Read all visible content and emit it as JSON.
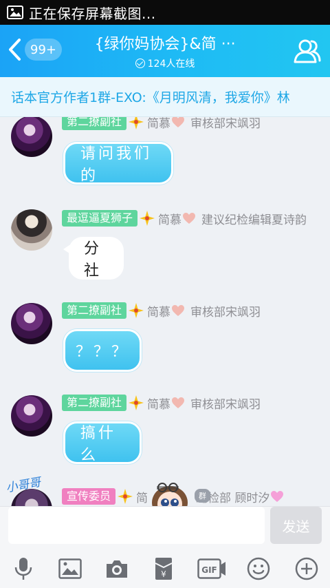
{
  "status_bar": {
    "text": "正在保存屏幕截图..."
  },
  "header": {
    "unread_badge": "99+",
    "title": "{绿你妈协会}&简 ···",
    "online_text": "124人在线"
  },
  "notice": {
    "text": "话本官方作者1群-EXO:《月明风清，我爱你》林"
  },
  "messages": [
    {
      "tag": "第二撩副社",
      "nickname": "简慕",
      "role": "审核部宋飒羽",
      "text": "请问我们的",
      "bubble": "blue",
      "avatar": "purple"
    },
    {
      "tag": "最逗逼夏狮子",
      "nickname": "简慕",
      "role": "建议纪检编辑夏诗韵",
      "text": "分社",
      "bubble": "white",
      "avatar": "dark"
    },
    {
      "tag": "第二撩副社",
      "nickname": "简慕",
      "role": "审核部宋飒羽",
      "text": "？？？",
      "bubble": "blue",
      "avatar": "purple"
    },
    {
      "tag": "第二撩副社",
      "nickname": "简慕",
      "role": "审核部宋飒羽",
      "text": "搞什么",
      "bubble": "blue",
      "avatar": "purple"
    },
    {
      "tag": "宣传委员",
      "nickname": "简",
      "role": "纪检部 顾时汐",
      "text": "",
      "bubble": "none",
      "avatar": "mixed"
    }
  ],
  "overlay": {
    "sticker_text": "小哥哥",
    "mini_tag": "群"
  },
  "input": {
    "placeholder": "",
    "send_label": "发送"
  },
  "toolbar": {
    "icons": [
      "microphone-icon",
      "image-icon",
      "camera-icon",
      "red-packet-icon",
      "gif-icon",
      "emoji-icon",
      "plus-icon"
    ]
  },
  "colors": {
    "header_start": "#1ba3f6",
    "header_end": "#22c6f1",
    "tag_green": "#5ed59d",
    "tag_pink": "#f080c0",
    "bubble_blue": "#3fc2ef",
    "notice_text": "#1ea7e6"
  }
}
